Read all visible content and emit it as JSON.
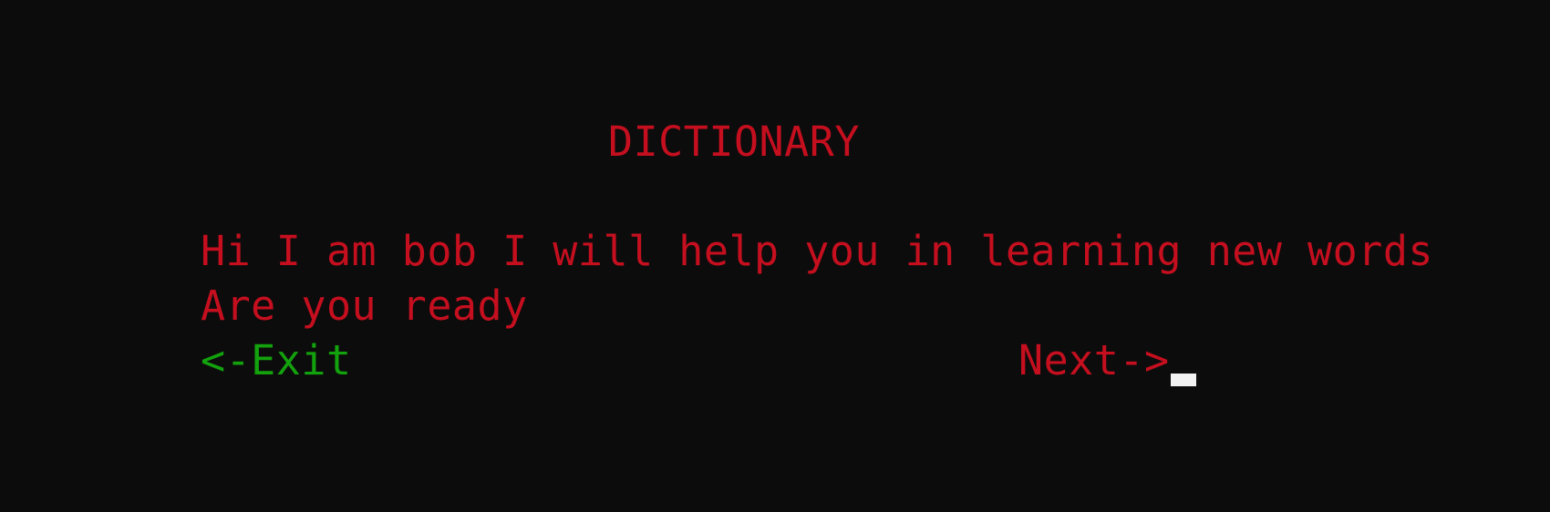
{
  "title": "DICTIONARY",
  "intro_text": "Hi I am bob I will help you in learning new words",
  "prompt_text": "Are you ready",
  "exit_option": "<-Exit",
  "next_option": "Next->",
  "colors": {
    "background": "#0c0c0c",
    "text_primary": "#c50f1f",
    "text_selected": "#13a10e",
    "cursor": "#f2f2f2"
  }
}
